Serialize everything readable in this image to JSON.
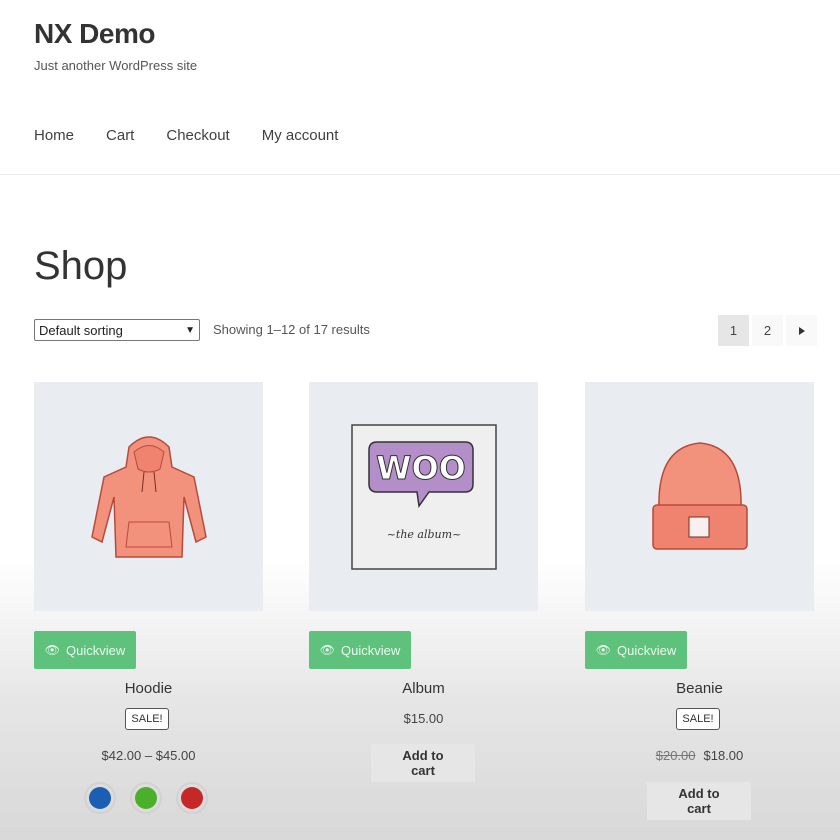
{
  "site": {
    "title": "NX Demo",
    "tagline": "Just another WordPress site"
  },
  "nav": [
    "Home",
    "Cart",
    "Checkout",
    "My account"
  ],
  "page": {
    "title": "Shop"
  },
  "sorting": {
    "selected": "Default sorting"
  },
  "results": {
    "text": "Showing 1–12 of 17 results"
  },
  "pagination": {
    "pages": [
      "1",
      "2"
    ],
    "current": "1",
    "next_icon": "triangle-right-icon"
  },
  "quickview_label": "Quickview",
  "sale_label": "SALE!",
  "products": [
    {
      "name": "Hoodie",
      "sale": true,
      "price_range": "$42.00 – $45.00",
      "swatches": [
        "#1a5fb4",
        "#4caf2a",
        "#c62828"
      ]
    },
    {
      "name": "Album",
      "sale": false,
      "price": "$15.00",
      "button": "Add to cart",
      "image_text_logo": "WOO",
      "image_text_caption": "~the album~"
    },
    {
      "name": "Beanie",
      "sale": true,
      "old_price": "$20.00",
      "price": "$18.00",
      "button": "Add to cart"
    }
  ],
  "colors": {
    "quickview_bg": "#5ec17c",
    "button_bg": "#e6e6e6"
  }
}
